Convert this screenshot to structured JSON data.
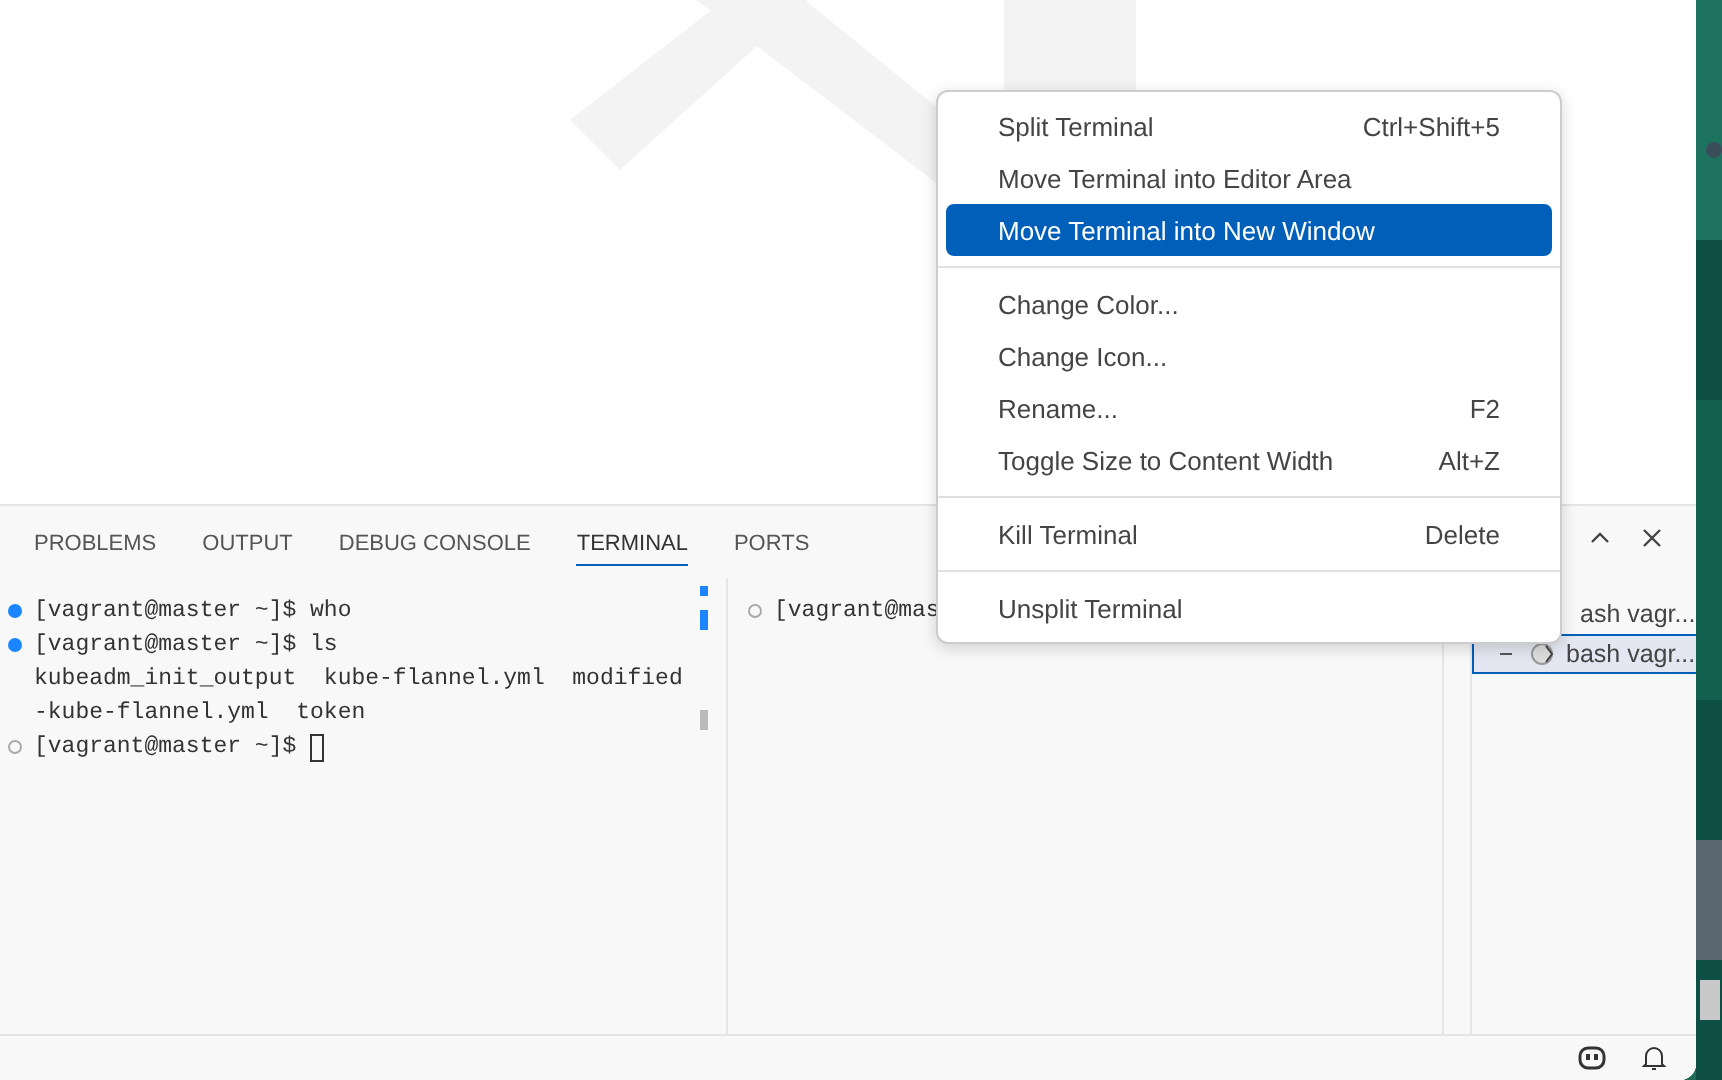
{
  "panel": {
    "tabs": [
      {
        "label": "PROBLEMS",
        "selected": false
      },
      {
        "label": "OUTPUT",
        "selected": false
      },
      {
        "label": "DEBUG CONSOLE",
        "selected": false
      },
      {
        "label": "TERMINAL",
        "selected": true
      },
      {
        "label": "PORTS",
        "selected": false
      }
    ]
  },
  "terminals": [
    {
      "lines": [
        {
          "kind": "success",
          "text": "[vagrant@master ~]$ who"
        },
        {
          "kind": "success",
          "text": "[vagrant@master ~]$ ls"
        },
        {
          "kind": "output",
          "text": "kubeadm_init_output  kube-flannel.yml  modified"
        },
        {
          "kind": "output",
          "text": "-kube-flannel.yml  token"
        },
        {
          "kind": "pending",
          "text": "[vagrant@master ~]$",
          "cursor": true
        }
      ]
    },
    {
      "lines": [
        {
          "kind": "pending",
          "text": "[vagrant@mas"
        }
      ]
    }
  ],
  "terminal_list": [
    {
      "label": "ash vagr...",
      "selected": false
    },
    {
      "label": "bash vagr...",
      "selected": true
    }
  ],
  "context_menu": {
    "groups": [
      [
        {
          "label": "Split Terminal",
          "shortcut": "Ctrl+Shift+5",
          "selected": false
        },
        {
          "label": "Move Terminal into Editor Area",
          "selected": false
        },
        {
          "label": "Move Terminal into New Window",
          "selected": true
        }
      ],
      [
        {
          "label": "Change Color...",
          "selected": false
        },
        {
          "label": "Change Icon...",
          "selected": false
        },
        {
          "label": "Rename...",
          "shortcut": "F2",
          "selected": false
        },
        {
          "label": "Toggle Size to Content Width",
          "shortcut": "Alt+Z",
          "selected": false
        }
      ],
      [
        {
          "label": "Kill Terminal",
          "shortcut": "Delete",
          "selected": false
        }
      ],
      [
        {
          "label": "Unsplit Terminal",
          "selected": false
        }
      ]
    ]
  }
}
